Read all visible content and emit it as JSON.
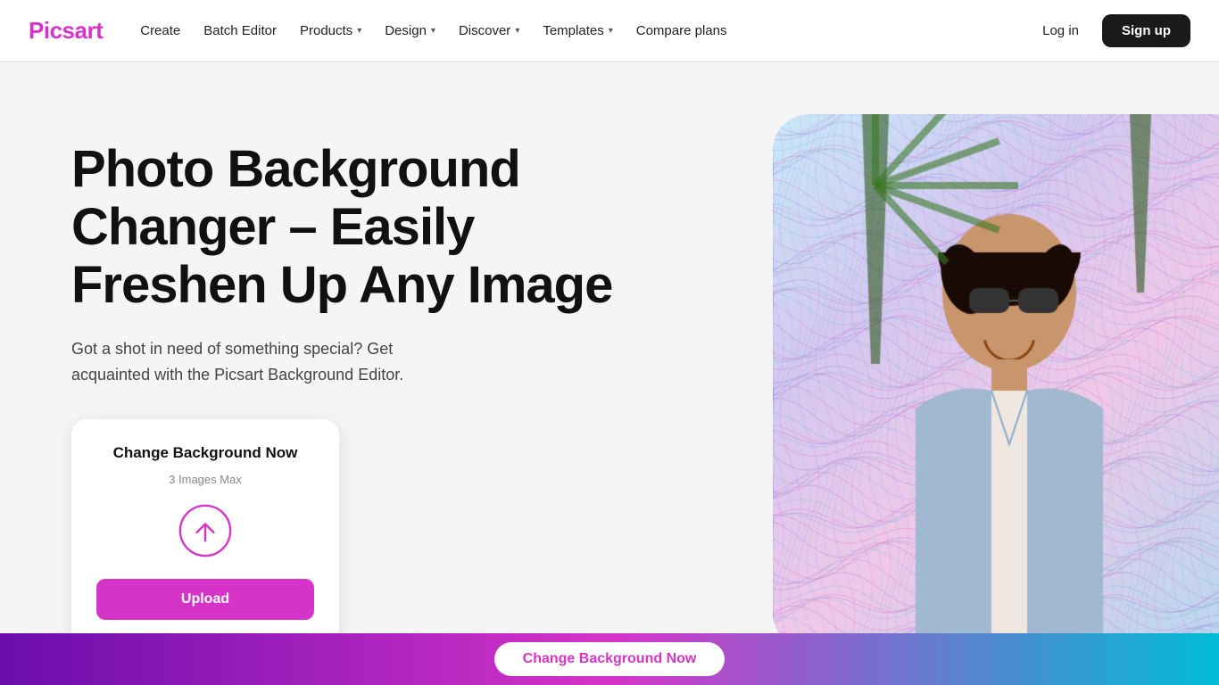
{
  "navbar": {
    "logo": "Picsart",
    "links": [
      {
        "label": "Create",
        "has_dropdown": false
      },
      {
        "label": "Batch Editor",
        "has_dropdown": false
      },
      {
        "label": "Products",
        "has_dropdown": true
      },
      {
        "label": "Design",
        "has_dropdown": true
      },
      {
        "label": "Discover",
        "has_dropdown": true
      },
      {
        "label": "Templates",
        "has_dropdown": true
      },
      {
        "label": "Compare plans",
        "has_dropdown": false
      }
    ],
    "login_label": "Log in",
    "signup_label": "Sign up"
  },
  "hero": {
    "title": "Photo Background Changer – Easily Freshen Up Any Image",
    "subtitle": "Got a shot in need of something special? Get acquainted with the Picsart Background Editor.",
    "upload_card": {
      "title": "Change Background Now",
      "subtitle": "3 Images Max",
      "upload_label": "Upload",
      "upload_icon": "upload-cloud-icon"
    }
  },
  "bottom_bar": {
    "cta_label": "Change Background Now"
  },
  "colors": {
    "brand_pink": "#d633c8",
    "dark": "#1a1a1a",
    "bg": "#f5f5f5"
  }
}
